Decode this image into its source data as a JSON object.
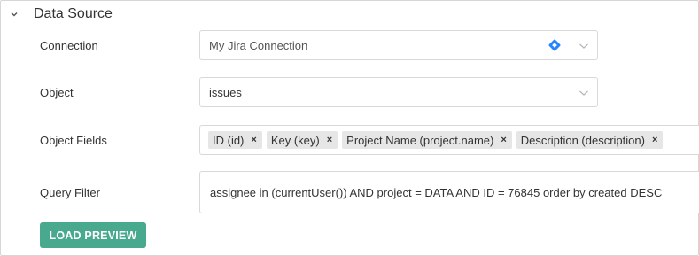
{
  "section": {
    "title": "Data Source",
    "collapse_icon": "chevron-down-icon"
  },
  "connection": {
    "label": "Connection",
    "value": "My Jira Connection",
    "icon": "jira-diamond-icon",
    "icon_color": "#2684ff"
  },
  "object": {
    "label": "Object",
    "value": "issues"
  },
  "object_fields": {
    "label": "Object Fields",
    "tags": [
      {
        "label": "ID (id)"
      },
      {
        "label": "Key (key)"
      },
      {
        "label": "Project.Name (project.name)"
      },
      {
        "label": "Description (description)"
      }
    ],
    "remove_glyph": "×"
  },
  "query_filter": {
    "label": "Query Filter",
    "value": "assignee in (currentUser()) AND project = DATA  AND ID = 76845  order by created DESC"
  },
  "load_preview": {
    "label": "LOAD PREVIEW",
    "color": "#48a98e"
  }
}
